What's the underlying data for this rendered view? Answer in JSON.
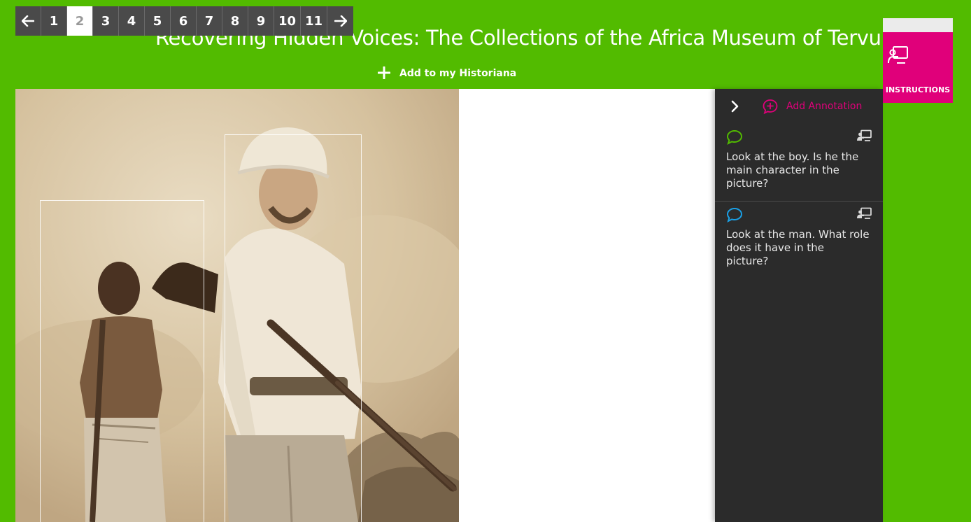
{
  "title": "Recovering Hidden Voices: The Collections of the Africa Museum of Tervuren",
  "pagination": {
    "prev_icon": "arrow-left-icon",
    "next_icon": "arrow-right-icon",
    "pages": [
      "1",
      "2",
      "3",
      "4",
      "5",
      "6",
      "7",
      "8",
      "9",
      "10",
      "11"
    ],
    "active_page": "2"
  },
  "add_to_historiana": {
    "icon": "plus-icon",
    "label": "Add to my Historiana"
  },
  "instructions": {
    "icon": "teacher-board-icon",
    "label": "INSTRUCTIONS"
  },
  "panel": {
    "collapse_icon": "chevron-right-icon",
    "add_annotation": {
      "icon": "speech-bubble-plus-icon",
      "label": "Add Annotation"
    },
    "annotations": [
      {
        "bubble_color": "#52bb00",
        "text": "Look at the boy. Is he the main character in the picture?"
      },
      {
        "bubble_color": "#1aa0e6",
        "text": "Look at the man. What role does it have in the picture?"
      }
    ]
  },
  "colors": {
    "page_bg": "#52bb00",
    "pagination_bg": "#4a4a4a",
    "accent_pink": "#e0007a",
    "panel_bg": "#2b2b2b"
  }
}
